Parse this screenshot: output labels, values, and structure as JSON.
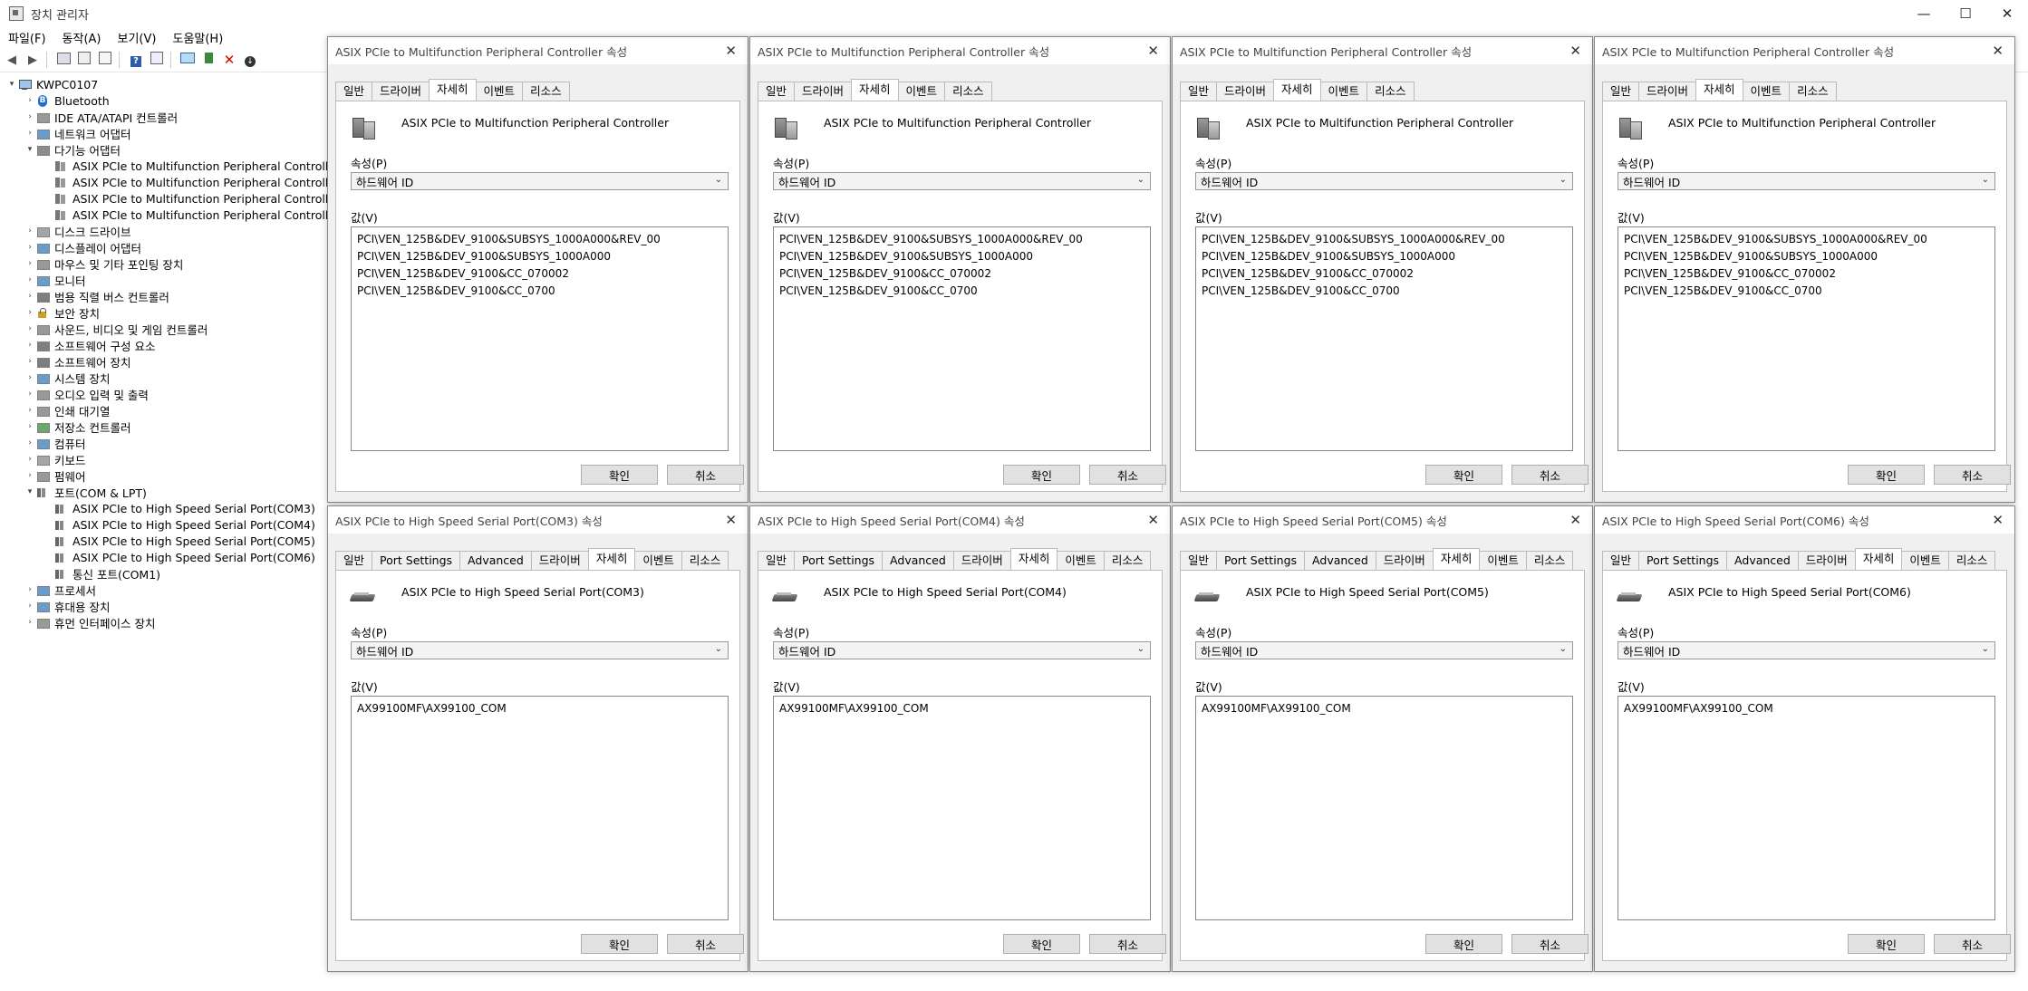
{
  "window": {
    "title": "장치 관리자",
    "controls": [
      "—",
      "☐",
      "✕"
    ]
  },
  "menu": [
    "파일(F)",
    "동작(A)",
    "보기(V)",
    "도움말(H)"
  ],
  "toolbar": {
    "icons": [
      "back-icon",
      "forward-icon",
      "show-hide-console-tree-icon",
      "properties-icon",
      "refresh-icon",
      "help-icon",
      "action-pane-icon",
      "monitor-icon",
      "update-driver-icon",
      "uninstall-icon",
      "disable-icon"
    ]
  },
  "tree": {
    "root": "KWPC0107",
    "items": [
      {
        "label": "Bluetooth",
        "level": 1,
        "expanded": false,
        "icon": "bluetooth-icon"
      },
      {
        "label": "IDE ATA/ATAPI 컨트롤러",
        "level": 1,
        "expanded": false,
        "icon": "ide-controller-icon"
      },
      {
        "label": "네트워크 어댑터",
        "level": 1,
        "expanded": false,
        "icon": "network-adapter-icon"
      },
      {
        "label": "다기능 어댑터",
        "level": 1,
        "expanded": true,
        "icon": "multifunction-adapter-icon"
      },
      {
        "label": "ASIX PCIe to Multifunction Peripheral Controller",
        "level": 2,
        "icon": "multifunction-device-icon"
      },
      {
        "label": "ASIX PCIe to Multifunction Peripheral Controller",
        "level": 2,
        "icon": "multifunction-device-icon"
      },
      {
        "label": "ASIX PCIe to Multifunction Peripheral Controller",
        "level": 2,
        "icon": "multifunction-device-icon"
      },
      {
        "label": "ASIX PCIe to Multifunction Peripheral Controller",
        "level": 2,
        "icon": "multifunction-device-icon"
      },
      {
        "label": "디스크 드라이브",
        "level": 1,
        "expanded": false,
        "icon": "disk-drive-icon"
      },
      {
        "label": "디스플레이 어댑터",
        "level": 1,
        "expanded": false,
        "icon": "display-adapter-icon"
      },
      {
        "label": "마우스 및 기타 포인팅 장치",
        "level": 1,
        "expanded": false,
        "icon": "mouse-icon"
      },
      {
        "label": "모니터",
        "level": 1,
        "expanded": false,
        "icon": "monitor-icon"
      },
      {
        "label": "범용 직렬 버스 컨트롤러",
        "level": 1,
        "expanded": false,
        "icon": "usb-controller-icon"
      },
      {
        "label": "보안 장치",
        "level": 1,
        "expanded": false,
        "icon": "security-device-icon"
      },
      {
        "label": "사운드, 비디오 및 게임 컨트롤러",
        "level": 1,
        "expanded": false,
        "icon": "sound-icon"
      },
      {
        "label": "소프트웨어 구성 요소",
        "level": 1,
        "expanded": false,
        "icon": "software-component-icon"
      },
      {
        "label": "소프트웨어 장치",
        "level": 1,
        "expanded": false,
        "icon": "software-device-icon"
      },
      {
        "label": "시스템 장치",
        "level": 1,
        "expanded": false,
        "icon": "system-device-icon"
      },
      {
        "label": "오디오 입력 및 출력",
        "level": 1,
        "expanded": false,
        "icon": "audio-io-icon"
      },
      {
        "label": "인쇄 대기열",
        "level": 1,
        "expanded": false,
        "icon": "print-queue-icon"
      },
      {
        "label": "저장소 컨트롤러",
        "level": 1,
        "expanded": false,
        "icon": "storage-controller-icon"
      },
      {
        "label": "컴퓨터",
        "level": 1,
        "expanded": false,
        "icon": "computer-icon"
      },
      {
        "label": "키보드",
        "level": 1,
        "expanded": false,
        "icon": "keyboard-icon"
      },
      {
        "label": "펌웨어",
        "level": 1,
        "expanded": false,
        "icon": "firmware-icon"
      },
      {
        "label": "포트(COM & LPT)",
        "level": 1,
        "expanded": true,
        "icon": "port-icon"
      },
      {
        "label": "ASIX PCIe to High Speed Serial Port(COM3)",
        "level": 2,
        "icon": "serial-port-icon"
      },
      {
        "label": "ASIX PCIe to High Speed Serial Port(COM4)",
        "level": 2,
        "icon": "serial-port-icon"
      },
      {
        "label": "ASIX PCIe to High Speed Serial Port(COM5)",
        "level": 2,
        "icon": "serial-port-icon"
      },
      {
        "label": "ASIX PCIe to High Speed Serial Port(COM6)",
        "level": 2,
        "icon": "serial-port-icon"
      },
      {
        "label": "통신 포트(COM1)",
        "level": 2,
        "icon": "serial-port-icon"
      },
      {
        "label": "프로세서",
        "level": 1,
        "expanded": false,
        "icon": "processor-icon"
      },
      {
        "label": "휴대용 장치",
        "level": 1,
        "expanded": false,
        "icon": "portable-device-icon"
      },
      {
        "label": "휴먼 인터페이스 장치",
        "level": 1,
        "expanded": false,
        "icon": "hid-icon"
      }
    ]
  },
  "labels": {
    "property": "속성(P)",
    "value": "값(V)",
    "ok": "확인",
    "cancel": "취소"
  },
  "dialogs": [
    {
      "title": "ASIX PCIe to Multifunction Peripheral Controller 속성",
      "tabs": [
        "일반",
        "드라이버",
        "자세히",
        "이벤트",
        "리소스"
      ],
      "active_tab": 2,
      "device": "ASIX PCIe to Multifunction Peripheral Controller",
      "device_icon": "multifunction-device-icon",
      "property": "하드웨어 ID",
      "values": [
        "PCI\\VEN_125B&DEV_9100&SUBSYS_1000A000&REV_00",
        "PCI\\VEN_125B&DEV_9100&SUBSYS_1000A000",
        "PCI\\VEN_125B&DEV_9100&CC_070002",
        "PCI\\VEN_125B&DEV_9100&CC_0700"
      ]
    },
    {
      "title": "ASIX PCIe to Multifunction Peripheral Controller 속성",
      "tabs": [
        "일반",
        "드라이버",
        "자세히",
        "이벤트",
        "리소스"
      ],
      "active_tab": 2,
      "device": "ASIX PCIe to Multifunction Peripheral Controller",
      "device_icon": "multifunction-device-icon",
      "property": "하드웨어 ID",
      "values": [
        "PCI\\VEN_125B&DEV_9100&SUBSYS_1000A000&REV_00",
        "PCI\\VEN_125B&DEV_9100&SUBSYS_1000A000",
        "PCI\\VEN_125B&DEV_9100&CC_070002",
        "PCI\\VEN_125B&DEV_9100&CC_0700"
      ]
    },
    {
      "title": "ASIX PCIe to Multifunction Peripheral Controller 속성",
      "tabs": [
        "일반",
        "드라이버",
        "자세히",
        "이벤트",
        "리소스"
      ],
      "active_tab": 2,
      "device": "ASIX PCIe to Multifunction Peripheral Controller",
      "device_icon": "multifunction-device-icon",
      "property": "하드웨어 ID",
      "values": [
        "PCI\\VEN_125B&DEV_9100&SUBSYS_1000A000&REV_00",
        "PCI\\VEN_125B&DEV_9100&SUBSYS_1000A000",
        "PCI\\VEN_125B&DEV_9100&CC_070002",
        "PCI\\VEN_125B&DEV_9100&CC_0700"
      ]
    },
    {
      "title": "ASIX PCIe to Multifunction Peripheral Controller 속성",
      "tabs": [
        "일반",
        "드라이버",
        "자세히",
        "이벤트",
        "리소스"
      ],
      "active_tab": 2,
      "device": "ASIX PCIe to Multifunction Peripheral Controller",
      "device_icon": "multifunction-device-icon",
      "property": "하드웨어 ID",
      "values": [
        "PCI\\VEN_125B&DEV_9100&SUBSYS_1000A000&REV_00",
        "PCI\\VEN_125B&DEV_9100&SUBSYS_1000A000",
        "PCI\\VEN_125B&DEV_9100&CC_070002",
        "PCI\\VEN_125B&DEV_9100&CC_0700"
      ]
    },
    {
      "title": "ASIX PCIe to High Speed Serial Port(COM3) 속성",
      "tabs": [
        "일반",
        "Port Settings",
        "Advanced",
        "드라이버",
        "자세히",
        "이벤트",
        "리소스"
      ],
      "active_tab": 4,
      "device": "ASIX PCIe to High Speed Serial Port(COM3)",
      "device_icon": "serial-port-icon",
      "property": "하드웨어 ID",
      "values": [
        "AX99100MF\\AX99100_COM"
      ]
    },
    {
      "title": "ASIX PCIe to High Speed Serial Port(COM4) 속성",
      "tabs": [
        "일반",
        "Port Settings",
        "Advanced",
        "드라이버",
        "자세히",
        "이벤트",
        "리소스"
      ],
      "active_tab": 4,
      "device": "ASIX PCIe to High Speed Serial Port(COM4)",
      "device_icon": "serial-port-icon",
      "property": "하드웨어 ID",
      "values": [
        "AX99100MF\\AX99100_COM"
      ]
    },
    {
      "title": "ASIX PCIe to High Speed Serial Port(COM5) 속성",
      "tabs": [
        "일반",
        "Port Settings",
        "Advanced",
        "드라이버",
        "자세히",
        "이벤트",
        "리소스"
      ],
      "active_tab": 4,
      "device": "ASIX PCIe to High Speed Serial Port(COM5)",
      "device_icon": "serial-port-icon",
      "property": "하드웨어 ID",
      "values": [
        "AX99100MF\\AX99100_COM"
      ]
    },
    {
      "title": "ASIX PCIe to High Speed Serial Port(COM6) 속성",
      "tabs": [
        "일반",
        "Port Settings",
        "Advanced",
        "드라이버",
        "자세히",
        "이벤트",
        "리소스"
      ],
      "active_tab": 4,
      "device": "ASIX PCIe to High Speed Serial Port(COM6)",
      "device_icon": "serial-port-icon",
      "property": "하드웨어 ID",
      "values": [
        "AX99100MF\\AX99100_COM"
      ]
    }
  ]
}
